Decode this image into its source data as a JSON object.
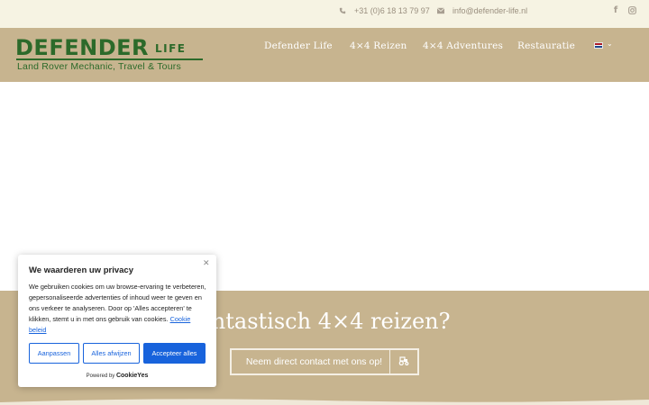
{
  "topbar": {
    "phone": "+31 (0)6 18 13 79 97",
    "email": "info@defender-life.nl",
    "social": [
      "facebook-icon",
      "instagram-icon"
    ]
  },
  "logo": {
    "main": "DEFENDER",
    "suffix": "LIFE",
    "tagline": "Land Rover Mechanic, Travel & Tours",
    "color": "#2c6a2a"
  },
  "nav": {
    "items": [
      "Defender Life",
      "4×4 Reizen",
      "4×4 Adventures",
      "Restauratie"
    ],
    "language_flag": "nl-flag-icon"
  },
  "band": {
    "title": "antastisch 4×4 reizen?",
    "cta_label": "Neem direct contact met ons op!",
    "cta_icon": "tractor-icon",
    "color": "#c7b48f"
  },
  "cookie": {
    "title": "We waarderen uw privacy",
    "text": "We gebruiken cookies om uw browse-ervaring te verbeteren, gepersonaliseerde advertenties of inhoud weer te geven en ons verkeer te analyseren. Door op 'Alles accepteren' te klikken, stemt u in met ons gebruik van cookies.",
    "link": "Cookie beleid",
    "buttons": {
      "customize": "Aanpassen",
      "reject": "Alles afwijzen",
      "accept": "Accepteer alles"
    },
    "powered_prefix": "Powered by",
    "powered_brand": "CookieYes",
    "accent": "#1863dc"
  }
}
